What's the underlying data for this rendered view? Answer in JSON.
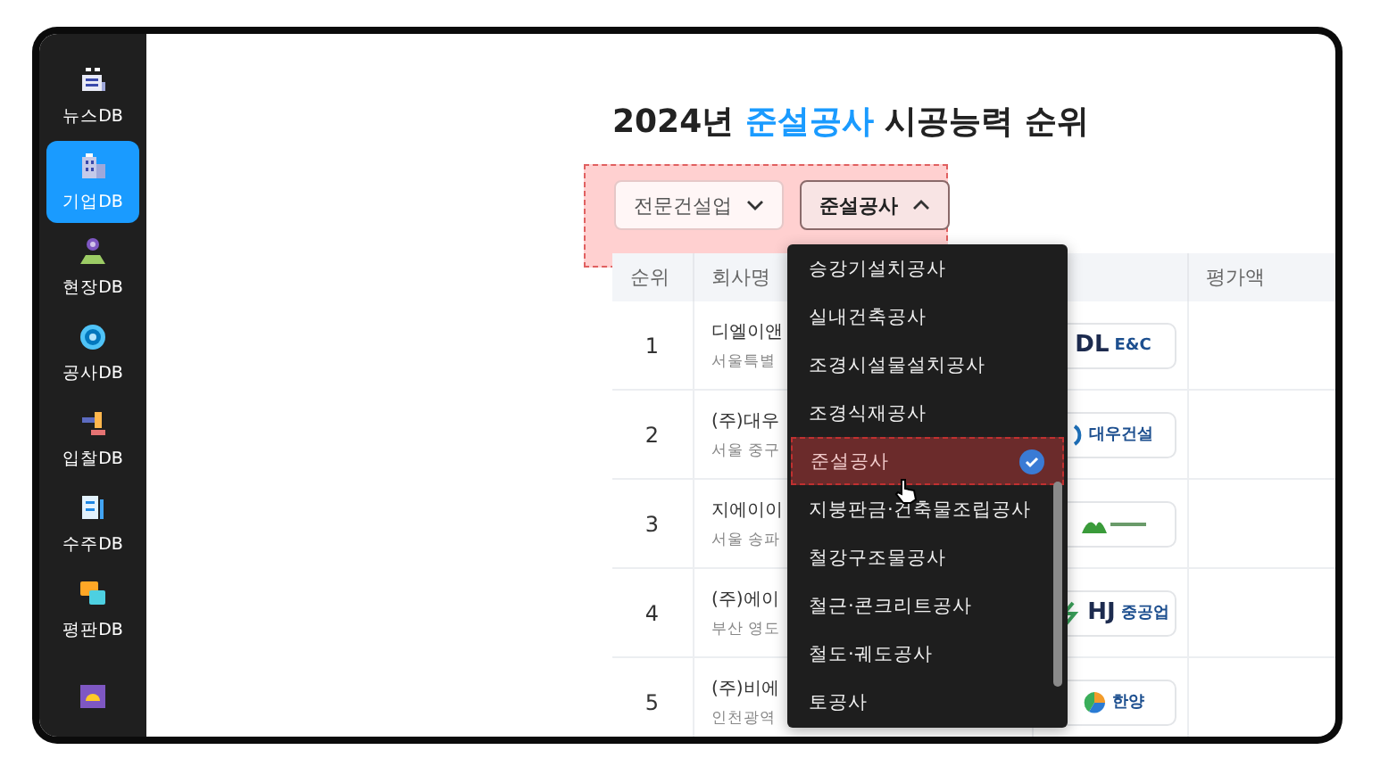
{
  "sidebar": {
    "items": [
      {
        "kind": "news",
        "label": "뉴스DB",
        "selected": false
      },
      {
        "kind": "building",
        "label": "기업DB",
        "selected": true
      },
      {
        "kind": "site",
        "label": "현장DB",
        "selected": false
      },
      {
        "kind": "gear",
        "label": "공사DB",
        "selected": false
      },
      {
        "kind": "gavel",
        "label": "입찰DB",
        "selected": false
      },
      {
        "kind": "document",
        "label": "수주DB",
        "selected": false
      },
      {
        "kind": "chat",
        "label": "평판DB",
        "selected": false
      },
      {
        "kind": "helmet",
        "selected": false
      }
    ]
  },
  "title": {
    "year": "2024년",
    "highlight": "준설공사",
    "rest": "시공능력 순위"
  },
  "filters": [
    {
      "label": "전문건설업",
      "expanded": false
    },
    {
      "label": "준설공사",
      "expanded": true
    }
  ],
  "table": {
    "columns": [
      "순위",
      "회사명",
      "평가액"
    ],
    "rows": [
      {
        "rank": "1",
        "name": "디엘이앤",
        "address": "서울특별",
        "logo": {
          "kind": "dl",
          "mark": "DL",
          "text": "E&C"
        }
      },
      {
        "rank": "2",
        "name": "(주)대우",
        "address": "서울 중구",
        "logo": {
          "kind": "daewoo",
          "text": "대우건설"
        }
      },
      {
        "rank": "3",
        "name": "지에이이",
        "address": "서울 송파",
        "logo": {
          "kind": "leaf"
        }
      },
      {
        "rank": "4",
        "name": "(주)에이",
        "address": "부산 영도",
        "logo": {
          "kind": "hj",
          "mark": "HJ",
          "text": "중공업"
        }
      },
      {
        "rank": "5",
        "name": "(주)비에",
        "address": "인천광역",
        "logo": {
          "kind": "hanyang",
          "text": "한양"
        }
      }
    ]
  },
  "dropdown": {
    "items": [
      {
        "label": "승강기설치공사",
        "selected": false
      },
      {
        "label": "실내건축공사",
        "selected": false
      },
      {
        "label": "조경시설물설치공사",
        "selected": false
      },
      {
        "label": "조경식재공사",
        "selected": false
      },
      {
        "label": "준설공사",
        "selected": true
      },
      {
        "label": "지붕판금·건축물조립공사",
        "selected": false
      },
      {
        "label": "철강구조물공사",
        "selected": false
      },
      {
        "label": "철근·콘크리트공사",
        "selected": false
      },
      {
        "label": "철도·궤도공사",
        "selected": false
      },
      {
        "label": "토공사",
        "selected": false
      }
    ]
  }
}
